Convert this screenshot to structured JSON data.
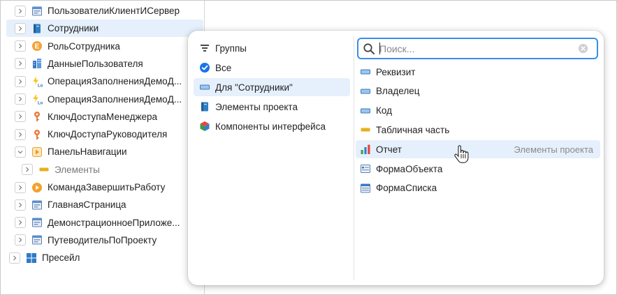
{
  "tree": {
    "items": [
      {
        "label": "ПользователиКлиентИСервер",
        "icon": "form-icon",
        "muted": false
      },
      {
        "label": "Сотрудники",
        "icon": "catalog-book-icon",
        "muted": false,
        "selected": true
      },
      {
        "label": "РольСотрудника",
        "icon": "enum-e-icon",
        "muted": false
      },
      {
        "label": "ДанныеПользователя",
        "icon": "data-building-icon",
        "muted": false
      },
      {
        "label": "ОперацияЗаполненияДемоД...",
        "icon": "log-operation-icon",
        "muted": false
      },
      {
        "label": "ОперацияЗаполненияДемоД...",
        "icon": "log-operation-icon",
        "muted": false
      },
      {
        "label": "КлючДоступаМенеджера",
        "icon": "access-key-icon",
        "muted": false
      },
      {
        "label": "КлючДоступаРуководителя",
        "icon": "access-key-icon",
        "muted": false
      },
      {
        "label": "ПанельНавигации",
        "icon": "nav-panel-icon",
        "muted": false,
        "expanded": true
      },
      {
        "label": "Элементы",
        "icon": "tabular-part-icon",
        "muted": true,
        "indent": true
      },
      {
        "label": "КомандаЗавершитьРаботу",
        "icon": "command-play-icon",
        "muted": false
      },
      {
        "label": "ГлавнаяСтраница",
        "icon": "form-icon",
        "muted": false
      },
      {
        "label": "ДемонстрационноеПриложе...",
        "icon": "form-icon",
        "muted": false
      },
      {
        "label": "ПутеводительПоПроекту",
        "icon": "form-icon",
        "muted": false
      },
      {
        "label": "Пресейл",
        "icon": "grid-project-icon",
        "muted": false,
        "outdent": true
      }
    ]
  },
  "popup": {
    "groups_header": "Группы",
    "groups": [
      {
        "label": "Все",
        "icon": "check-circle-icon"
      },
      {
        "label": "Для \"Сотрудники\"",
        "icon": "attribute-icon",
        "selected": true
      },
      {
        "label": "Элементы проекта",
        "icon": "catalog-book-icon"
      },
      {
        "label": "Компоненты интерфейса",
        "icon": "cube-icon"
      }
    ],
    "search": {
      "placeholder": "Поиск...",
      "value": ""
    },
    "elements": [
      {
        "label": "Реквизит",
        "icon": "attribute-icon"
      },
      {
        "label": "Владелец",
        "icon": "attribute-icon"
      },
      {
        "label": "Код",
        "icon": "attribute-icon"
      },
      {
        "label": "Табличная часть",
        "icon": "tabular-part-icon"
      },
      {
        "label": "Отчет",
        "icon": "report-chart-icon",
        "hover": true,
        "hint": "Элементы проекта"
      },
      {
        "label": "ФормаОбъекта",
        "icon": "object-form-icon"
      },
      {
        "label": "ФормаСписка",
        "icon": "list-form-icon"
      }
    ]
  },
  "colors": {
    "accent": "#3a8ee6",
    "selection": "#e5f0fc"
  }
}
